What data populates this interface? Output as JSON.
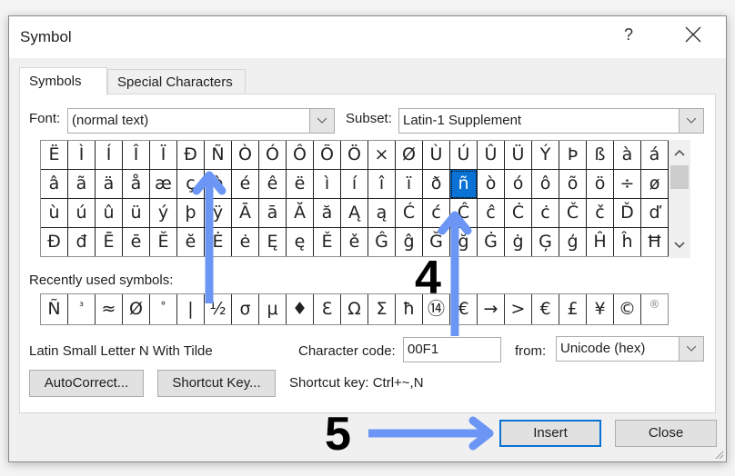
{
  "dialog": {
    "title": "Symbol",
    "help_label": "?",
    "close_icon": "close-x-icon"
  },
  "tabs": [
    {
      "label": "Symbols",
      "accel": "S",
      "active": true
    },
    {
      "label": "Special Characters",
      "accel": "p",
      "active": false
    }
  ],
  "font": {
    "label": "Font:",
    "value": "(normal text)"
  },
  "subset": {
    "label": "Subset:",
    "value": "Latin-1 Supplement"
  },
  "symbol_grid": {
    "rows": [
      [
        "Ë",
        "Ì",
        "Í",
        "Î",
        "Ï",
        "Ð",
        "Ñ",
        "Ò",
        "Ó",
        "Ô",
        "Õ",
        "Ö",
        "×",
        "Ø",
        "Ù",
        "Ú",
        "Û",
        "Ü",
        "Ý",
        "Þ",
        "ß",
        "à",
        "á"
      ],
      [
        "â",
        "ã",
        "ä",
        "å",
        "æ",
        "ç",
        "è",
        "é",
        "ê",
        "ë",
        "ì",
        "í",
        "î",
        "ï",
        "ð",
        "ñ",
        "ò",
        "ó",
        "ô",
        "õ",
        "ö",
        "÷",
        "ø"
      ],
      [
        "ù",
        "ú",
        "û",
        "ü",
        "ý",
        "þ",
        "ÿ",
        "Ā",
        "ā",
        "Ă",
        "ă",
        "Ą",
        "ą",
        "Ć",
        "ć",
        "Ĉ",
        "ĉ",
        "Ċ",
        "ċ",
        "Č",
        "č",
        "Ď",
        "ď"
      ],
      [
        "Đ",
        "đ",
        "Ē",
        "ē",
        "Ĕ",
        "ĕ",
        "Ė",
        "ė",
        "Ę",
        "ę",
        "Ě",
        "ě",
        "Ĝ",
        "ĝ",
        "Ğ",
        "ğ",
        "Ġ",
        "ġ",
        "Ģ",
        "ģ",
        "Ĥ",
        "ĥ",
        "Ħ"
      ]
    ],
    "selected": {
      "row": 1,
      "col": 15,
      "char": "ñ"
    }
  },
  "recent": {
    "label": "Recently used symbols:",
    "symbols": [
      "Ñ",
      "³",
      "≈",
      "Ø",
      "°",
      "|",
      "½",
      "σ",
      "μ",
      "♦",
      "Ɛ",
      "Ω",
      "Σ",
      "ħ",
      "⑭",
      "€",
      "→",
      ">",
      "€",
      "£",
      "¥",
      "©",
      "®"
    ]
  },
  "char_name": "Latin Small Letter N With Tilde",
  "char_code": {
    "label": "Character code:",
    "value": "00F1"
  },
  "from": {
    "label": "from:",
    "value": "Unicode (hex)"
  },
  "buttons": {
    "autocorrect": "AutoCorrect...",
    "shortcut_key": "Shortcut Key...",
    "insert": "Insert",
    "close": "Close"
  },
  "shortcut_text": "Shortcut key: Ctrl+~,N",
  "annotations": {
    "step4": "4",
    "step5": "5",
    "arrow_color": "#6b96f5"
  }
}
